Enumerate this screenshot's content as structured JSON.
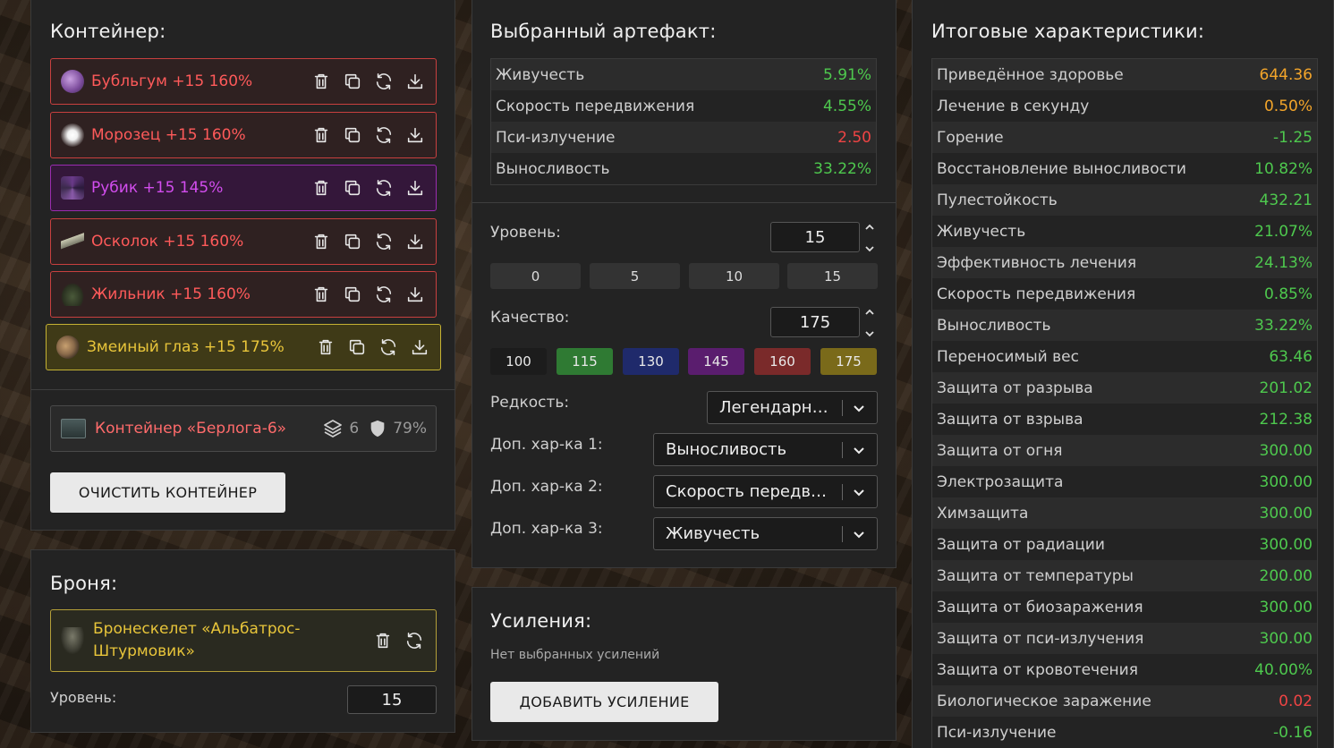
{
  "container_panel": {
    "title": "Контейнер:",
    "artifacts": [
      {
        "name": "Бубльгум +15 160%",
        "color": "red"
      },
      {
        "name": "Морозец +15 160%",
        "color": "red"
      },
      {
        "name": "Рубик +15 145%",
        "color": "purple"
      },
      {
        "name": "Осколок +15 160%",
        "color": "red"
      },
      {
        "name": "Жильник +15 160%",
        "color": "red"
      },
      {
        "name": "Змеиный глаз +15 175%",
        "color": "gold"
      }
    ],
    "container": {
      "name": "Контейнер «Берлога-6»",
      "slots": "6",
      "protection": "79%"
    },
    "clear_button": "ОЧИСТИТЬ КОНТЕЙНЕР"
  },
  "armor_panel": {
    "title": "Броня:",
    "armor_name": "Бронескелет «Альбатрос-Штурмовик»",
    "level_label": "Уровень:",
    "level_value": "15"
  },
  "selected_panel": {
    "title": "Выбранный артефакт:",
    "stats": [
      {
        "label": "Живучесть",
        "value": "5.91%",
        "tone": "green"
      },
      {
        "label": "Скорость передвижения",
        "value": "4.55%",
        "tone": "green"
      },
      {
        "label": "Пси-излучение",
        "value": "2.50",
        "tone": "red"
      },
      {
        "label": "Выносливость",
        "value": "33.22%",
        "tone": "green"
      }
    ],
    "level_label": "Уровень:",
    "level_value": "15",
    "level_presets": [
      "0",
      "5",
      "10",
      "15"
    ],
    "quality_label": "Качество:",
    "quality_value": "175",
    "quality_presets": [
      {
        "label": "100",
        "color": "#1c1c1c"
      },
      {
        "label": "115",
        "color": "#2f7a33"
      },
      {
        "label": "130",
        "color": "#1f2a6b"
      },
      {
        "label": "145",
        "color": "#5a1d6e"
      },
      {
        "label": "160",
        "color": "#7a2a2a"
      },
      {
        "label": "175",
        "color": "#7a6a1a"
      }
    ],
    "rarity_label": "Редкость:",
    "rarity_value": "Легендарный",
    "extra1_label": "Доп. хар-ка 1:",
    "extra1_value": "Выносливость",
    "extra2_label": "Доп. хар-ка 2:",
    "extra2_value": "Скорость передвижения",
    "extra3_label": "Доп. хар-ка 3:",
    "extra3_value": "Живучесть"
  },
  "boosts_panel": {
    "title": "Усиления:",
    "empty_text": "Нет выбранных усилений",
    "add_button": "ДОБАВИТЬ УСИЛЕНИЕ"
  },
  "totals_panel": {
    "title": "Итоговые характеристики:",
    "stats": [
      {
        "label": "Приведённое здоровье",
        "value": "644.36",
        "tone": "orange"
      },
      {
        "label": "Лечение в секунду",
        "value": "0.50%",
        "tone": "orange"
      },
      {
        "label": "Горение",
        "value": "-1.25",
        "tone": "green"
      },
      {
        "label": "Восстановление выносливости",
        "value": "10.82%",
        "tone": "green"
      },
      {
        "label": "Пулестойкость",
        "value": "432.21",
        "tone": "green"
      },
      {
        "label": "Живучесть",
        "value": "21.07%",
        "tone": "green"
      },
      {
        "label": "Эффективность лечения",
        "value": "24.13%",
        "tone": "green"
      },
      {
        "label": "Скорость передвижения",
        "value": "0.85%",
        "tone": "green"
      },
      {
        "label": "Выносливость",
        "value": "33.22%",
        "tone": "green"
      },
      {
        "label": "Переносимый вес",
        "value": "63.46",
        "tone": "green"
      },
      {
        "label": "Защита от разрыва",
        "value": "201.02",
        "tone": "green"
      },
      {
        "label": "Защита от взрыва",
        "value": "212.38",
        "tone": "green"
      },
      {
        "label": "Защита от огня",
        "value": "300.00",
        "tone": "green"
      },
      {
        "label": "Электрозащита",
        "value": "300.00",
        "tone": "green"
      },
      {
        "label": "Химзащита",
        "value": "300.00",
        "tone": "green"
      },
      {
        "label": "Защита от радиации",
        "value": "300.00",
        "tone": "green"
      },
      {
        "label": "Защита от температуры",
        "value": "200.00",
        "tone": "green"
      },
      {
        "label": "Защита от биозаражения",
        "value": "300.00",
        "tone": "green"
      },
      {
        "label": "Защита от пси-излучения",
        "value": "300.00",
        "tone": "green"
      },
      {
        "label": "Защита от кровотечения",
        "value": "40.00%",
        "tone": "green"
      },
      {
        "label": "Биологическое заражение",
        "value": "0.02",
        "tone": "red"
      },
      {
        "label": "Пси-излучение",
        "value": "-0.16",
        "tone": "green"
      }
    ]
  },
  "colors": {
    "panel_bg": "#232323",
    "red_accent": "#c8403f",
    "purple_accent": "#9a2cb0",
    "gold_accent": "#c5b233",
    "positive": "#4ec94e",
    "negative": "#ef4444",
    "highlight": "#f3a52a"
  }
}
